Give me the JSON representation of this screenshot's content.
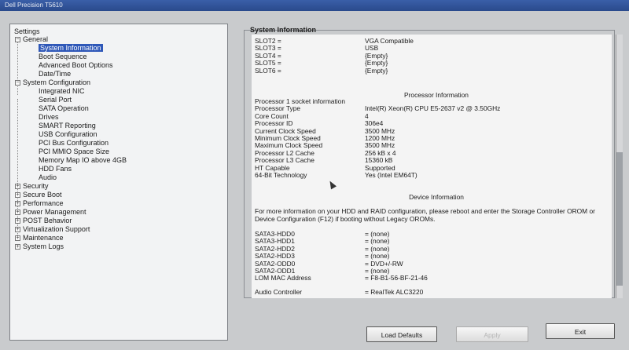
{
  "window": {
    "title": "Dell Precision T5610"
  },
  "tree": {
    "header": "Settings",
    "items": [
      {
        "label": "General",
        "expander": "−"
      },
      {
        "label": "System Information"
      },
      {
        "label": "Boot Sequence"
      },
      {
        "label": "Advanced Boot Options"
      },
      {
        "label": "Date/Time"
      },
      {
        "label": "System Configuration",
        "expander": "−"
      },
      {
        "label": "Integrated NIC"
      },
      {
        "label": "Serial Port"
      },
      {
        "label": "SATA Operation"
      },
      {
        "label": "Drives"
      },
      {
        "label": "SMART Reporting"
      },
      {
        "label": "USB Configuration"
      },
      {
        "label": "PCI Bus Configuration"
      },
      {
        "label": "PCI MMIO Space Size"
      },
      {
        "label": "Memory Map IO above 4GB"
      },
      {
        "label": "HDD Fans"
      },
      {
        "label": "Audio"
      },
      {
        "label": "Security",
        "expander": "+"
      },
      {
        "label": "Secure Boot",
        "expander": "+"
      },
      {
        "label": "Performance",
        "expander": "+"
      },
      {
        "label": "Power Management",
        "expander": "+"
      },
      {
        "label": "POST Behavior",
        "expander": "+"
      },
      {
        "label": "Virtualization Support",
        "expander": "+"
      },
      {
        "label": "Maintenance",
        "expander": "+"
      },
      {
        "label": "System Logs",
        "expander": "+"
      }
    ]
  },
  "info": {
    "title": "System Information",
    "slots": [
      {
        "k": "SLOT2 =",
        "v": "VGA Compatible"
      },
      {
        "k": "SLOT3 =",
        "v": "USB"
      },
      {
        "k": "SLOT4 =",
        "v": "{Empty}"
      },
      {
        "k": "SLOT5 =",
        "v": "{Empty}"
      },
      {
        "k": "SLOT6 =",
        "v": "{Empty}"
      }
    ],
    "processor_heading": "Processor Information",
    "processor": [
      {
        "k": "Processor 1 socket information",
        "v": ""
      },
      {
        "k": "Processor Type",
        "v": "Intel(R) Xeon(R) CPU E5-2637 v2 @ 3.50GHz"
      },
      {
        "k": "Core Count",
        "v": "4"
      },
      {
        "k": "Processor ID",
        "v": "306e4"
      },
      {
        "k": "Current Clock Speed",
        "v": "3500 MHz"
      },
      {
        "k": "Minimum Clock Speed",
        "v": "1200 MHz"
      },
      {
        "k": "Maximum Clock Speed",
        "v": "3500 MHz"
      },
      {
        "k": "Processor L2 Cache",
        "v": "256 kB x 4"
      },
      {
        "k": "Processor L3 Cache",
        "v": "15360 kB"
      },
      {
        "k": "HT Capable",
        "v": "Supported"
      },
      {
        "k": "64-Bit Technology",
        "v": "Yes (Intel EM64T)"
      }
    ],
    "device_heading": "Device Information",
    "device_note": "For more information on your HDD and RAID configuration, please reboot and enter the Storage Controller OROM or Device Configuration (F12) if booting without Legacy OROMs.",
    "devices": [
      {
        "k": "SATA3-HDD0",
        "v": "= (none)"
      },
      {
        "k": "SATA3-HDD1",
        "v": "= (none)"
      },
      {
        "k": "SATA2-HDD2",
        "v": "= (none)"
      },
      {
        "k": "SATA2-HDD3",
        "v": "= (none)"
      },
      {
        "k": "SATA2-ODD0",
        "v": "= DVD+/-RW"
      },
      {
        "k": "SATA2-ODD1",
        "v": "= (none)"
      },
      {
        "k": "LOM MAC Address",
        "v": "= F8-B1-56-BF-21-46"
      },
      {
        "k": "Audio Controller",
        "v": "= RealTek ALC3220"
      }
    ]
  },
  "buttons": {
    "load_defaults": "Load Defaults",
    "apply": "Apply",
    "exit": "Exit"
  }
}
